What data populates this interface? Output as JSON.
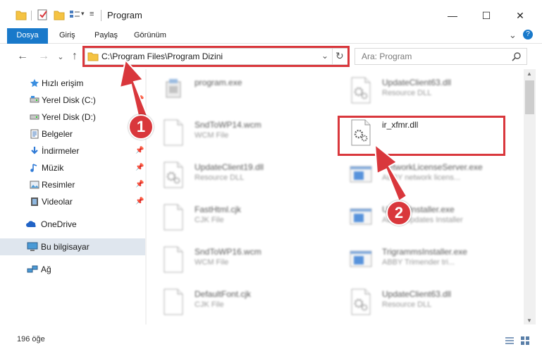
{
  "window": {
    "title": "Program",
    "minimize": "—",
    "maximize": "☐",
    "close": "✕"
  },
  "ribbon": {
    "tabs": [
      "Dosya",
      "Giriş",
      "Paylaş",
      "Görünüm"
    ],
    "collapse": "⌄",
    "help": "?"
  },
  "nav": {
    "back": "←",
    "forward": "→",
    "recent": "⌄",
    "up": "↑",
    "address": "C:\\Program Files\\Program Dizini",
    "address_dropdown": "⌄",
    "refresh": "↻",
    "search_placeholder": "Ara: Program"
  },
  "sidebar": {
    "items": [
      {
        "label": "Hızlı erişim",
        "icon": "star-icon"
      },
      {
        "label": "Yerel Disk (C:)",
        "icon": "drive-icon",
        "pinned": true
      },
      {
        "label": "Yerel Disk (D:)",
        "icon": "drive-icon",
        "pinned": true
      },
      {
        "label": "Belgeler",
        "icon": "documents-icon",
        "pinned": true
      },
      {
        "label": "İndirmeler",
        "icon": "download-icon",
        "pinned": true
      },
      {
        "label": "Müzik",
        "icon": "music-icon",
        "pinned": true
      },
      {
        "label": "Resimler",
        "icon": "pictures-icon",
        "pinned": true
      },
      {
        "label": "Videolar",
        "icon": "videos-icon",
        "pinned": true
      },
      {
        "label": "OneDrive",
        "icon": "cloud-icon"
      },
      {
        "label": "Bu bilgisayar",
        "icon": "computer-icon",
        "selected": true
      },
      {
        "label": "Ağ",
        "icon": "network-icon"
      }
    ]
  },
  "files": [
    {
      "name": "program.exe",
      "type": "",
      "col": 0,
      "row": 0
    },
    {
      "name": "UpdateClient63.dll",
      "type": "Resource DLL",
      "col": 1,
      "row": 0
    },
    {
      "name": "SndToWP14.wcm",
      "type": "WCM File",
      "col": 0,
      "row": 1
    },
    {
      "name": "ir_xfmr.dll",
      "type": "",
      "col": 1,
      "row": 1
    },
    {
      "name": "UpdateClient19.dll",
      "type": "Resource DLL",
      "col": 0,
      "row": 2
    },
    {
      "name": "NetworkLicenseServer.exe",
      "type": "ABBY network licens...",
      "col": 1,
      "row": 2
    },
    {
      "name": "FastHtml.cjk",
      "type": "CJK File",
      "col": 0,
      "row": 3
    },
    {
      "name": "UpdateInstaller.exe",
      "type": "ABBY Updates Installer",
      "col": 1,
      "row": 3
    },
    {
      "name": "SndToWP16.wcm",
      "type": "WCM File",
      "col": 0,
      "row": 4
    },
    {
      "name": "TrigrammsInstaller.exe",
      "type": "ABBY Trimender tri...",
      "col": 1,
      "row": 4
    },
    {
      "name": "DefaultFont.cjk",
      "type": "CJK File",
      "col": 0,
      "row": 5
    },
    {
      "name": "UpdateClient63.dll",
      "type": "Resource DLL",
      "col": 1,
      "row": 5
    }
  ],
  "status": {
    "count": "196 öğe"
  },
  "annotations": {
    "step1": "1",
    "step2": "2"
  },
  "colors": {
    "accent": "#1979ca",
    "annotation": "#d9373c",
    "selected": "#dfe6ee"
  }
}
